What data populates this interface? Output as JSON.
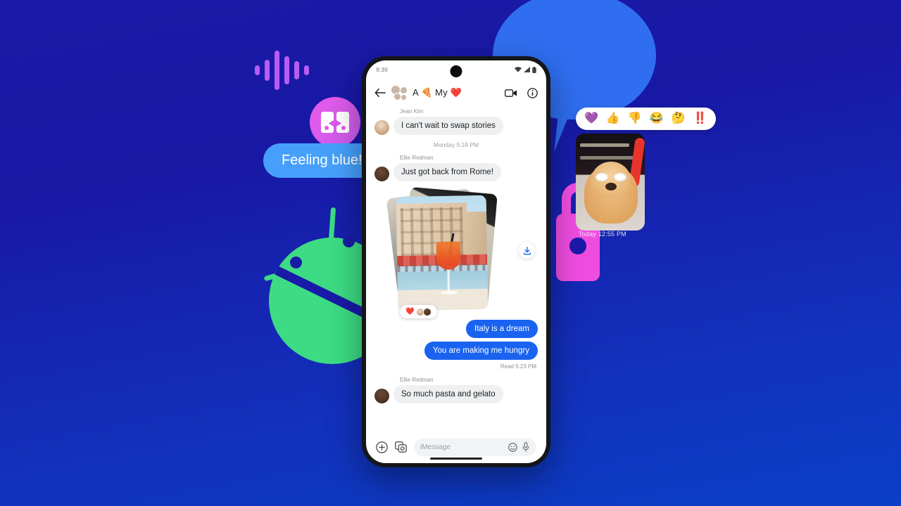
{
  "background": {
    "gradient_top": "#1a1aa8",
    "gradient_bottom": "#0b3fc6"
  },
  "decorations": {
    "waveform": {
      "name": "audio-waveform",
      "color": "#b95cf5",
      "bar_heights": [
        14,
        30,
        56,
        40,
        26,
        14
      ]
    },
    "badge_circle": {
      "name": "messages-badge",
      "color": "#e85ae8"
    },
    "feeling_bubble": {
      "text": "Feeling blue!",
      "color": "#46a0fb",
      "text_color": "#ffffff"
    },
    "android_robot": {
      "name": "android-robot",
      "color": "#3ddc84"
    },
    "padlock": {
      "name": "padlock",
      "color": "#ef4ce0"
    },
    "speech_bubble": {
      "name": "speech-bubble",
      "color": "#2f6ef0"
    },
    "reaction_bar": {
      "emojis": [
        "💜",
        "👍",
        "👎",
        "😂",
        "🤔",
        "‼️"
      ],
      "labels": [
        "heart",
        "thumbs-up",
        "thumbs-down",
        "laughing",
        "thinking",
        "double-exclamation"
      ]
    },
    "dog_card": {
      "name": "dog-photo",
      "caption": "Today  12:55 PM"
    }
  },
  "phone": {
    "statusbar": {
      "time": "9:30",
      "wifi": "wifi-icon",
      "signal": "signal-icon",
      "battery": "battery-icon"
    },
    "header": {
      "back": "back-arrow-icon",
      "title": "A 🍕 My ❤️",
      "video_call": "video-call-icon",
      "info": "info-icon"
    },
    "thread": {
      "messages": [
        {
          "type": "incoming",
          "sender": "Jean Kim",
          "text": "I can't wait to swap stories"
        },
        {
          "type": "daystamp",
          "text": "Monday 5:18 PM"
        },
        {
          "type": "incoming",
          "sender": "Ellie Redman",
          "text": "Just got back from Rome!"
        },
        {
          "type": "photo-stack",
          "sender": "",
          "reaction": "❤️",
          "download": "download-icon"
        },
        {
          "type": "outgoing",
          "text": "Italy is a dream"
        },
        {
          "type": "outgoing",
          "text": "You are making me hungry"
        },
        {
          "type": "status",
          "text": "Read  5:23 PM"
        },
        {
          "type": "incoming",
          "sender": "Ellie Redman",
          "text": "So much pasta and gelato"
        }
      ]
    },
    "composer": {
      "plus": "plus-circle-icon",
      "gallery": "camera-gallery-icon",
      "placeholder": "iMessage",
      "emoji": "emoji-icon",
      "mic": "microphone-icon"
    }
  }
}
